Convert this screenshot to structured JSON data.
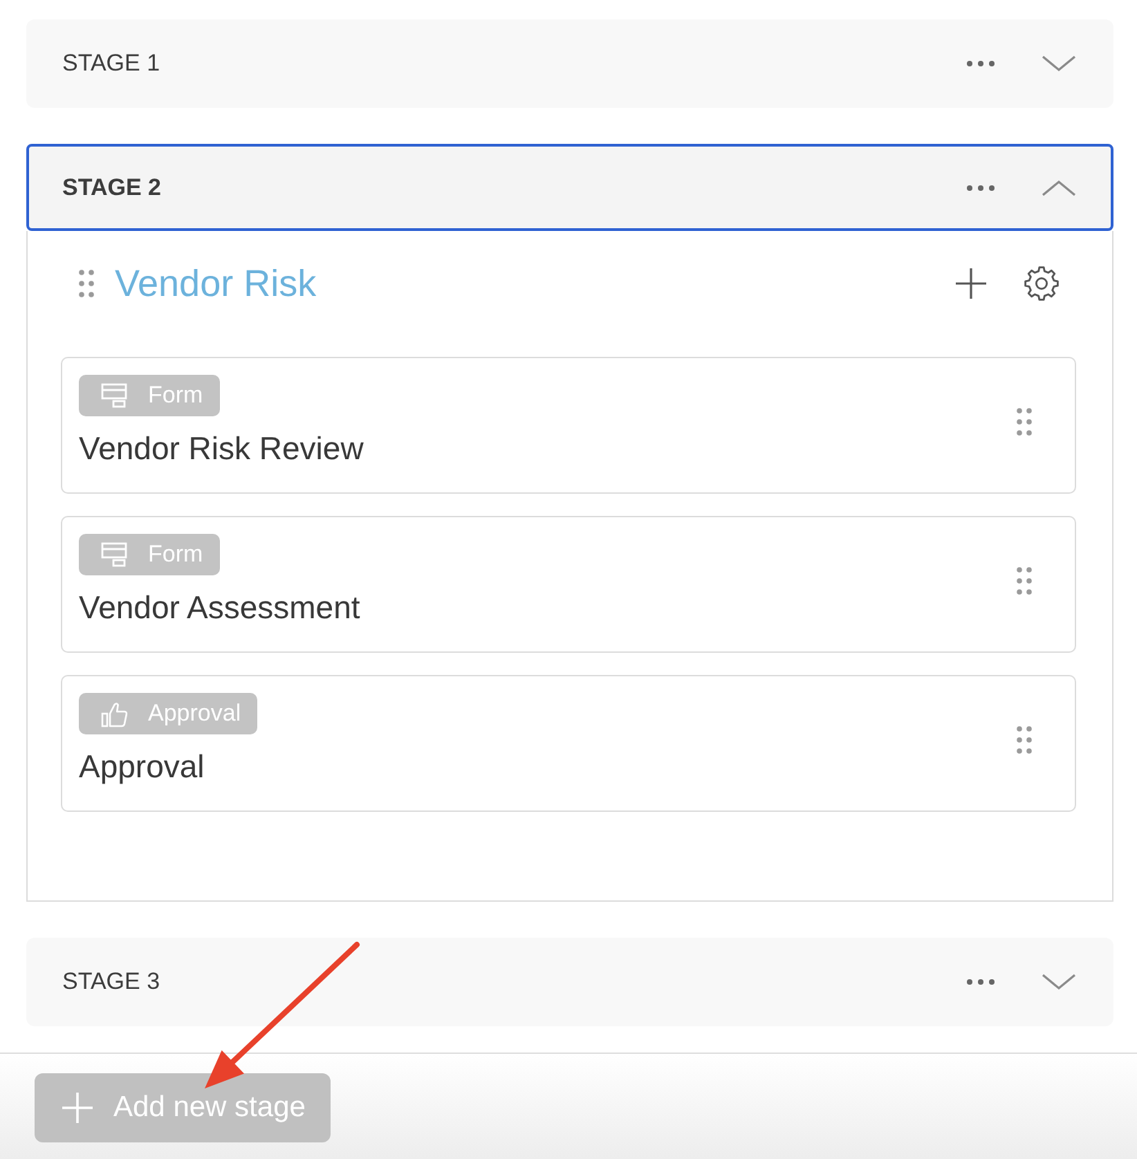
{
  "stages": [
    {
      "label": "STAGE 1",
      "expanded": false
    },
    {
      "label": "STAGE 2",
      "expanded": true,
      "groups": [
        {
          "title": "Vendor Risk",
          "steps": [
            {
              "kind": "form",
              "badge": "Form",
              "title": "Vendor Risk Review"
            },
            {
              "kind": "form",
              "badge": "Form",
              "title": "Vendor Assessment"
            },
            {
              "kind": "approval",
              "badge": "Approval",
              "title": "Approval"
            }
          ]
        }
      ]
    },
    {
      "label": "STAGE 3",
      "expanded": false
    }
  ],
  "add_stage_button": {
    "label": "Add new stage"
  },
  "annotation": {
    "kind": "arrow"
  }
}
